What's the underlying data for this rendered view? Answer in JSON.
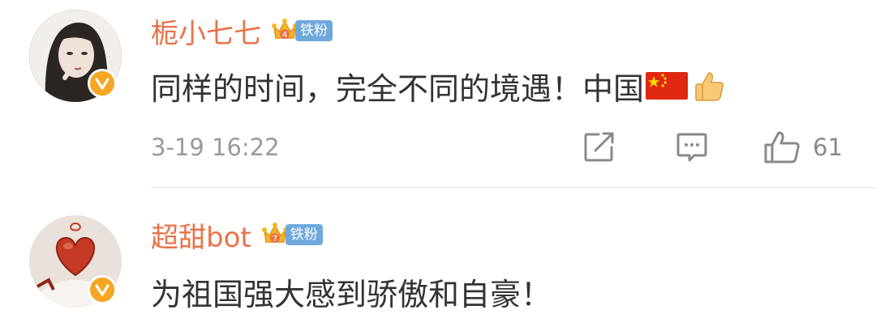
{
  "comments": [
    {
      "username": "栀小七七",
      "fan_badge": "铁粉",
      "text": "同样的时间，完全不同的境遇！中国",
      "emojis": [
        "china-flag",
        "thumbs-up"
      ],
      "timestamp": "3-19 16:22",
      "like_count": "61",
      "badge_level": "4"
    },
    {
      "username": "超甜bot",
      "fan_badge": "铁粉",
      "text": "为祖国强大感到骄傲和自豪！",
      "badge_level": "7"
    }
  ],
  "colors": {
    "username": "#e8734a",
    "text": "#333333",
    "meta": "#9a9a9a",
    "fan_badge_bg": "#6fa8dc",
    "verify_badge": "#f5a623"
  }
}
